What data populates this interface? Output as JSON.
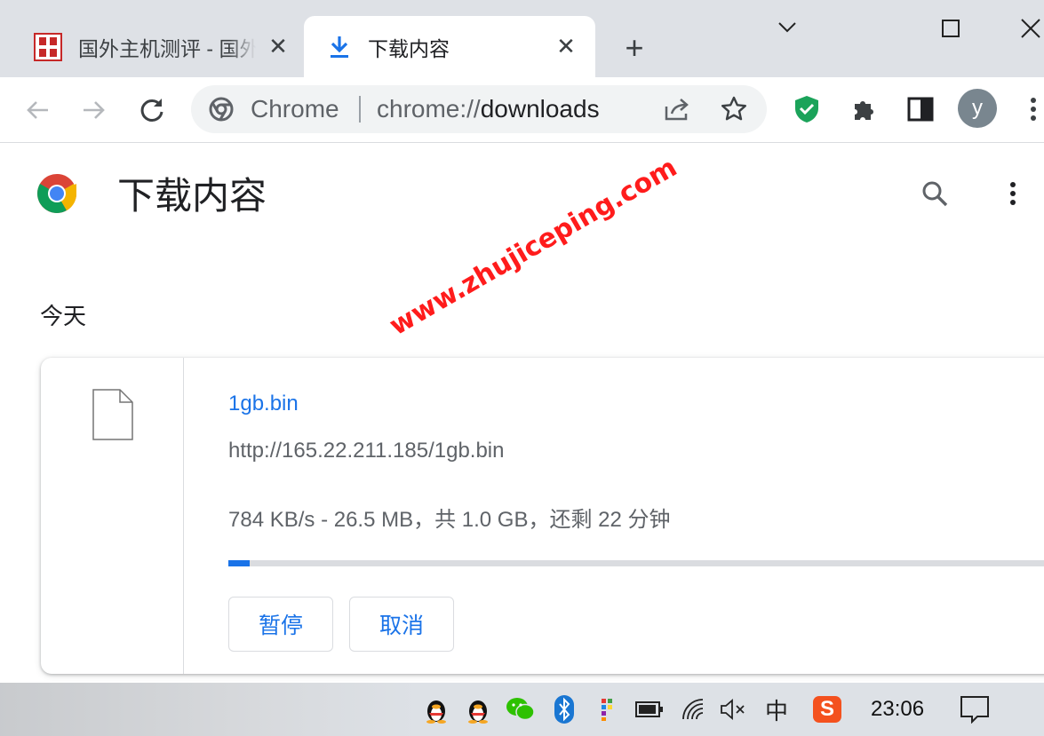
{
  "tabs": [
    {
      "title": "国外主机测评 - 国外",
      "active": false
    },
    {
      "title": "下载内容",
      "active": true
    }
  ],
  "omnibox": {
    "chip": "Chrome",
    "url_scheme": "chrome://",
    "url_path": "downloads"
  },
  "profile_initial": "y",
  "page": {
    "title": "下载内容",
    "section_date": "今天"
  },
  "download": {
    "file_name": "1gb.bin",
    "url": "http://165.22.211.185/1gb.bin",
    "status": "784 KB/s - 26.5 MB，共 1.0 GB，还剩 22 分钟",
    "progress_fraction": 0.0259,
    "pause_label": "暂停",
    "cancel_label": "取消"
  },
  "watermark": "www.zhujiceping.com",
  "taskbar": {
    "clock": "23:06",
    "ime": "中",
    "sogou": "S"
  },
  "colors": {
    "accent": "#1a73e8",
    "watermark": "#ff1c1c",
    "shield": "#1ba35a"
  }
}
